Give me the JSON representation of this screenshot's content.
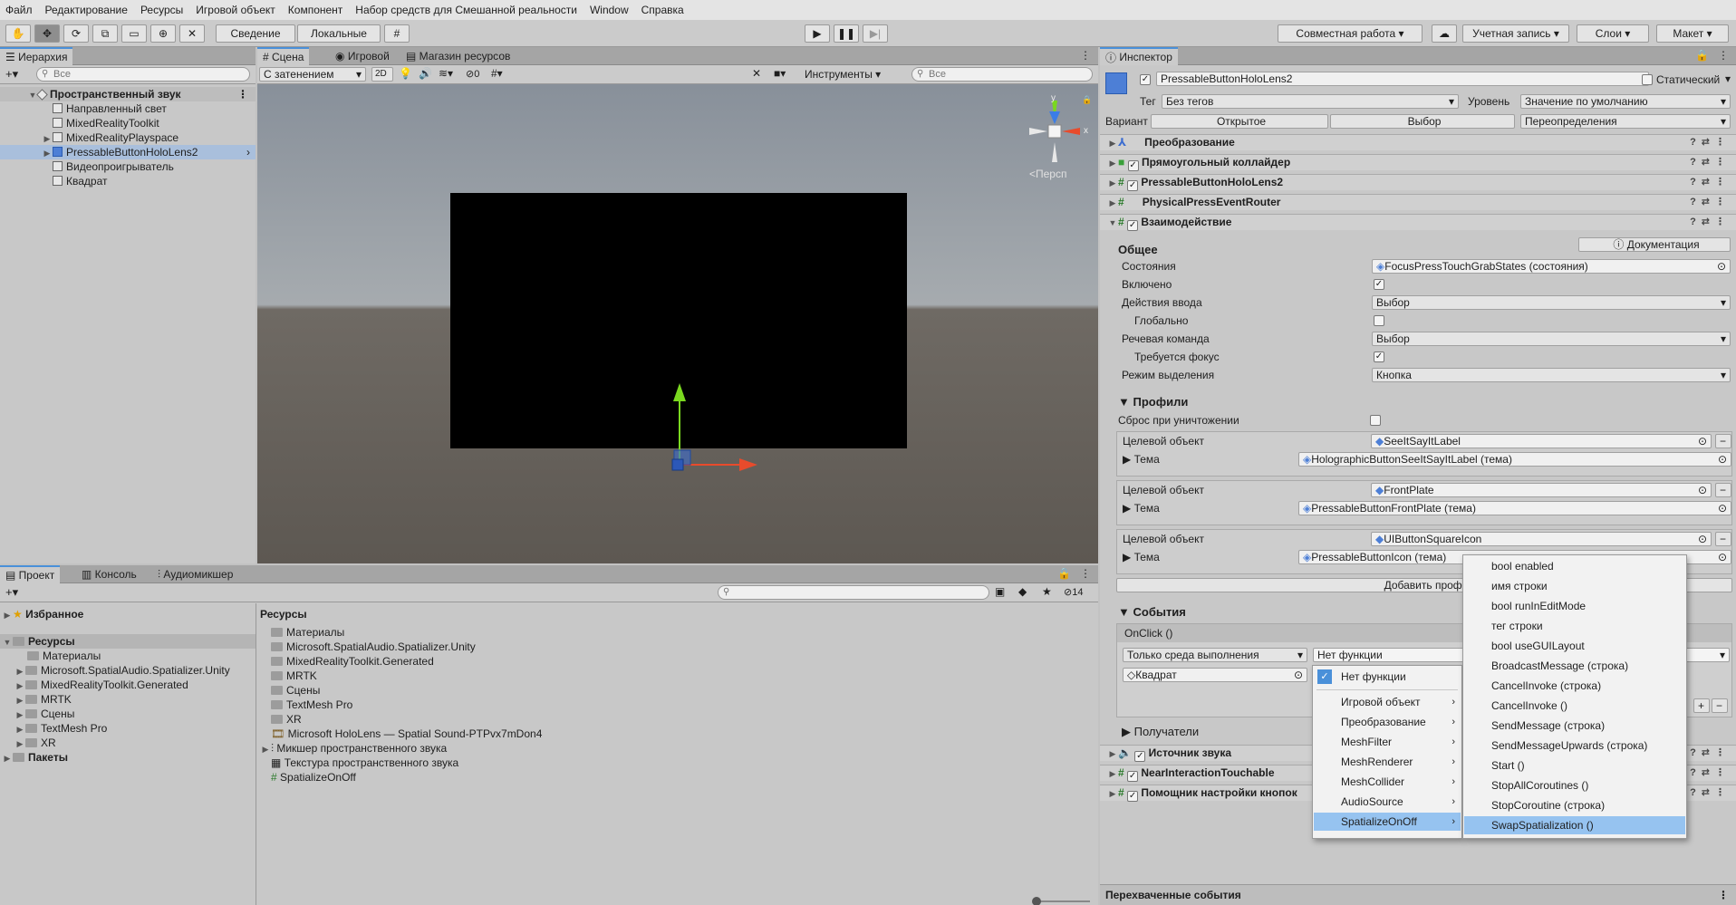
{
  "menubar": [
    "Файл",
    "Редактирование",
    "Ресурсы",
    "Игровой объект",
    "Компонент",
    "Набор средств для Смешанной реальности",
    "Window",
    "Справка"
  ],
  "toolbar": {
    "pivot": "Сведение",
    "space": "Локальные",
    "collab": "Совместная работа",
    "account": "Учетная запись",
    "layers": "Слои",
    "layout": "Макет"
  },
  "hierarchy": {
    "tab": "Иерархия",
    "search_placeholder": "Все",
    "scene": "Пространственный звук",
    "items": [
      "Направленный свет",
      "MixedRealityToolkit",
      "MixedRealityPlayspace",
      "PressableButtonHoloLens2",
      "Видеопроигрыватель",
      "Квадрат"
    ]
  },
  "scene_view": {
    "tabs": [
      "Сцена",
      "Игровой",
      "Магазин ресурсов"
    ],
    "shading": "С затенением",
    "mode_2d": "2D",
    "hidden_count": "0",
    "tools": "Инструменты",
    "search_placeholder": "Все",
    "gizmo_label": "<Персп",
    "axis_y": "y",
    "axis_x": "x"
  },
  "project": {
    "tabs": [
      "Проект",
      "Консоль",
      "Аудиомикшер"
    ],
    "count": "14",
    "favorites": "Избранное",
    "assets_root": "Ресурсы",
    "tree": [
      "Материалы",
      "Microsoft.SpatialAudio.Spatializer.Unity",
      "MixedRealityToolkit.Generated",
      "MRTK",
      "Сцены",
      "TextMesh Pro",
      "XR"
    ],
    "packages": "Пакеты",
    "breadcrumb": "Ресурсы",
    "files": [
      "Материалы",
      "Microsoft.SpatialAudio.Spatializer.Unity",
      "MixedRealityToolkit.Generated",
      "MRTK",
      "Сцены",
      "TextMesh Pro",
      "XR",
      "Microsoft HoloLens — Spatial Sound-PTPvx7mDon4",
      "Микшер пространственного звука",
      "Текстура пространственного звука",
      "SpatializeOnOff"
    ]
  },
  "inspector": {
    "tab": "Инспектор",
    "object_name": "PressableButtonHoloLens2",
    "static_label": "Статический",
    "tag_label": "Тег",
    "tag_value": "Без тегов",
    "layer_label": "Уровень",
    "layer_value": "Значение по умолчанию",
    "prefab_label": "Вариант",
    "prefab_open": "Открытое",
    "prefab_select": "Выбор",
    "prefab_overrides": "Переопределения",
    "components": [
      "Преобразование",
      "Прямоугольный коллайдер",
      "PressableButtonHoloLens2",
      "PhysicalPressEventRouter",
      "Взаимодействие"
    ],
    "docs_button": "Документация",
    "general_title": "Общее",
    "states_label": "Состояния",
    "states_value": "FocusPressTouchGrabStates (состояния)",
    "enabled_label": "Включено",
    "input_actions_label": "Действия ввода",
    "input_actions_value": "Выбор",
    "global_label": "Глобально",
    "speech_label": "Речевая команда",
    "speech_value": "Выбор",
    "requires_focus_label": "Требуется фокус",
    "selection_mode_label": "Режим выделения",
    "selection_mode_value": "Кнопка",
    "profiles_title": "Профили",
    "reset_label": "Сброс при уничтожении",
    "target_label": "Целевой объект",
    "theme_label": "Тема",
    "profiles": [
      {
        "target": "SeeItSayItLabel",
        "theme": "HolographicButtonSeeItSayItLabel (тема)"
      },
      {
        "target": "FrontPlate",
        "theme": "PressableButtonFrontPlate (тема)"
      },
      {
        "target": "UIButtonSquareIcon",
        "theme": "PressableButtonIcon (тема)"
      }
    ],
    "add_profile": "Добавить профи",
    "events_title": "События",
    "onclick": "OnClick ()",
    "runtime": "Только среда выполнения",
    "function": "Нет функции",
    "object": "Квадрат",
    "receivers": "Получатели",
    "more_components": [
      "Источник звука",
      "NearInteractionTouchable",
      "Помощник настройки кнопок"
    ],
    "intercepted": "Перехваченные события"
  },
  "menu1": {
    "items": [
      "Нет функции",
      "Игровой объект",
      "Преобразование",
      "MeshFilter",
      "MeshRenderer",
      "MeshCollider",
      "AudioSource",
      "SpatializeOnOff"
    ]
  },
  "menu2": {
    "items": [
      "bool enabled",
      "имя строки",
      "bool runInEditMode",
      "тег строки",
      "bool useGUILayout",
      "BroadcastMessage (строка)",
      "CancelInvoke (строка)",
      "CancelInvoke ()",
      "SendMessage (строка)",
      "SendMessageUpwards (строка)",
      "Start ()",
      "StopAllCoroutines ()",
      "StopCoroutine (строка)",
      "SwapSpatialization ()"
    ]
  },
  "colors": {
    "accent": "#4a90d9",
    "highlight": "#96c3f0",
    "selection": "#8fb4de"
  }
}
